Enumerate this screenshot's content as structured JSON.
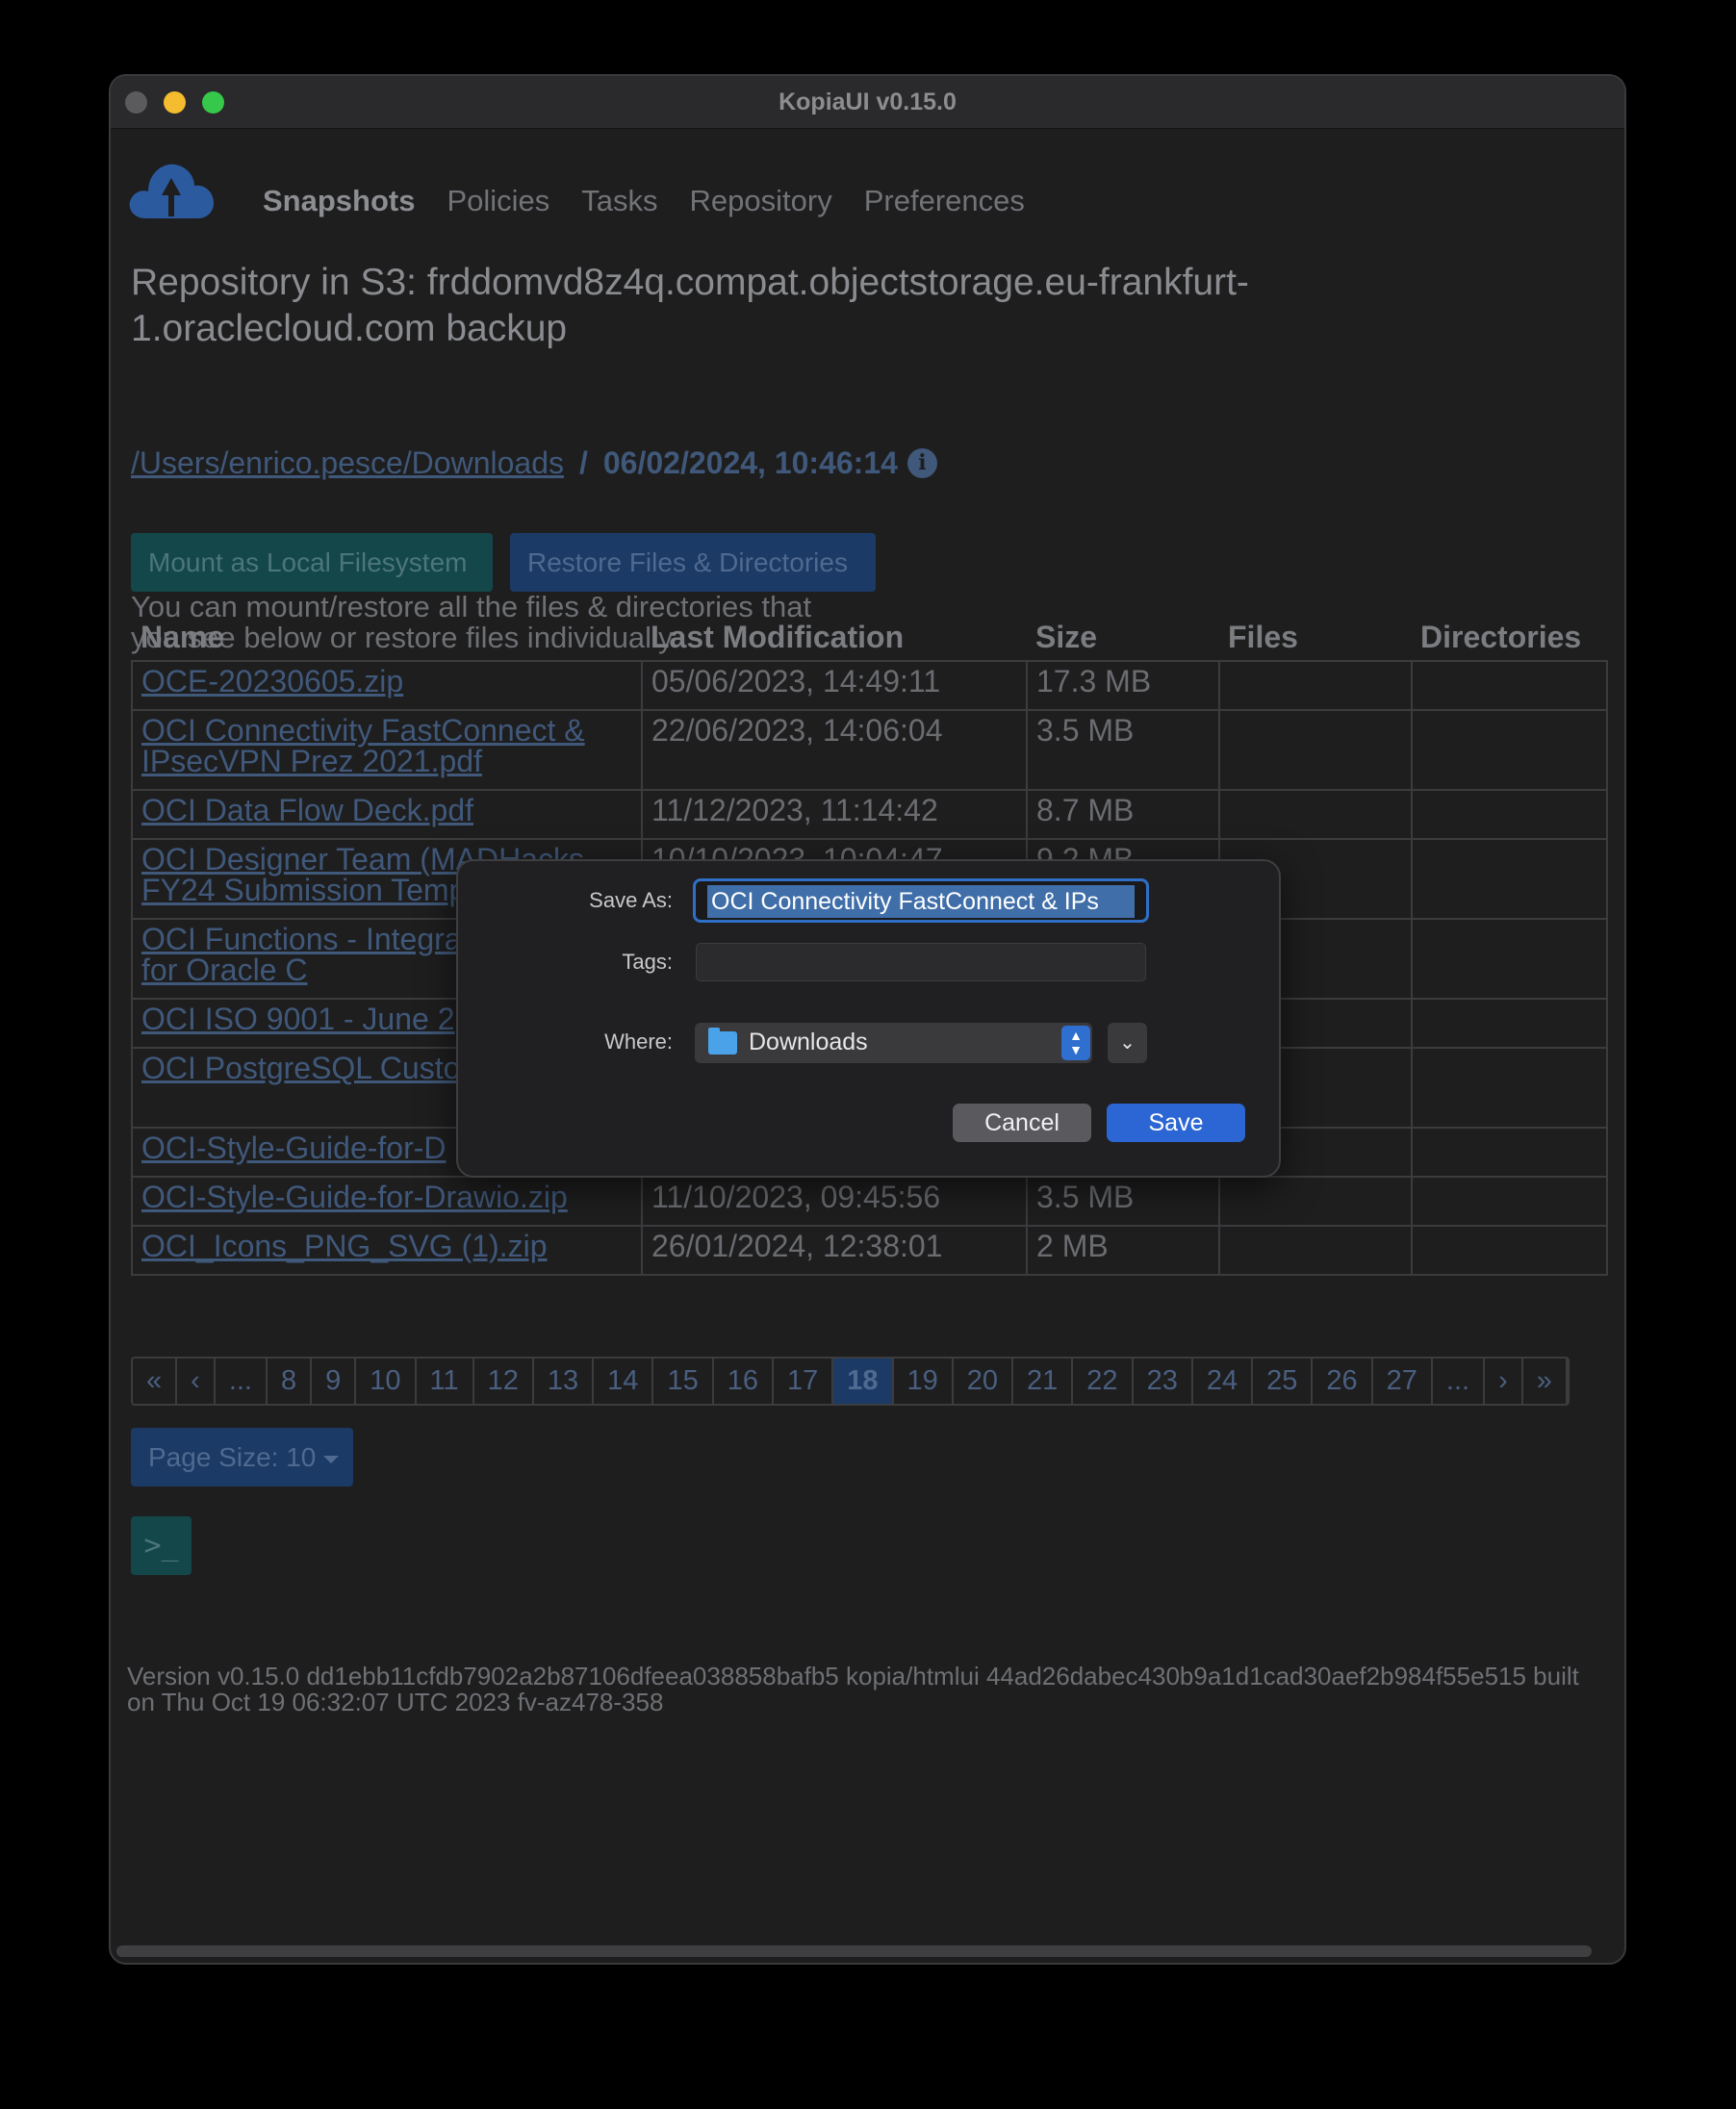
{
  "window": {
    "title": "KopiaUI v0.15.0"
  },
  "nav": {
    "items": [
      "Snapshots",
      "Policies",
      "Tasks",
      "Repository",
      "Preferences"
    ],
    "active": "Snapshots"
  },
  "repository": {
    "title": "Repository in S3: frddomvd8z4q.compat.objectstorage.eu-frankfurt-1.oraclecloud.com backup"
  },
  "breadcrumb": {
    "path": "/Users/enrico.pesce/Downloads",
    "separator": "/",
    "snapshot_time": "06/02/2024, 10:46:14",
    "info_icon": "info-circle-icon"
  },
  "actions": {
    "mount_label": "Mount as Local Filesystem",
    "restore_label": "Restore Files & Directories",
    "hint": "You can mount/restore all the files & directories that you see below or restore files individually."
  },
  "table": {
    "headers": [
      "Name",
      "Last Modification",
      "Size",
      "Files",
      "Directories"
    ],
    "rows": [
      {
        "name": "OCE-20230605.zip",
        "modified": "05/06/2023, 14:49:11",
        "size": "17.3 MB",
        "files": "",
        "dirs": ""
      },
      {
        "name": "OCI Connectivity FastConnect & IPsecVPN Prez 2021.pdf",
        "modified": "22/06/2023, 14:06:04",
        "size": "3.5 MB",
        "files": "",
        "dirs": ""
      },
      {
        "name": "OCI Data Flow Deck.pdf",
        "modified": "11/12/2023, 11:14:42",
        "size": "8.7 MB",
        "files": "",
        "dirs": ""
      },
      {
        "name": "OCI Designer Team (MADHacks FY24 Submission Temp",
        "modified": "10/10/2023, 10:04:47",
        "size": "9.2 MB",
        "files": "",
        "dirs": ""
      },
      {
        "name": "OCI Functions - Integra Monitoring for Oracle C",
        "modified": "",
        "size": "",
        "files": "",
        "dirs": ""
      },
      {
        "name": "OCI ISO 9001 - June 2",
        "modified": "",
        "size": "",
        "files": "",
        "dirs": ""
      },
      {
        "name": "OCI PostgreSQL Custo Deck.pptx",
        "modified": "",
        "size": "",
        "files": "",
        "dirs": ""
      },
      {
        "name": "OCI-Style-Guide-for-D",
        "modified": "",
        "size": "",
        "files": "",
        "dirs": ""
      },
      {
        "name": "OCI-Style-Guide-for-Drawio.zip",
        "modified": "11/10/2023, 09:45:56",
        "size": "3.5 MB",
        "files": "",
        "dirs": ""
      },
      {
        "name": "OCI_Icons_PNG_SVG (1).zip",
        "modified": "26/01/2024, 12:38:01",
        "size": "2 MB",
        "files": "",
        "dirs": ""
      }
    ]
  },
  "pagination": {
    "items": [
      "«",
      "‹",
      "...",
      "8",
      "9",
      "10",
      "11",
      "12",
      "13",
      "14",
      "15",
      "16",
      "17",
      "18",
      "19",
      "20",
      "21",
      "22",
      "23",
      "24",
      "25",
      "26",
      "27",
      "...",
      "›",
      "»"
    ],
    "active": "18"
  },
  "page_size": {
    "label": "Page Size: 10"
  },
  "terminal": {
    "icon": "terminal-icon",
    "glyph": ">_"
  },
  "footer": {
    "version": "Version v0.15.0 dd1ebb11cfdb7902a2b87106dfeea038858bafb5 kopia/htmlui 44ad26dabec430b9a1d1cad30aef2b984f55e515 built on Thu Oct 19 06:32:07 UTC 2023 fv-az478-358"
  },
  "save_dialog": {
    "save_as_label": "Save As:",
    "save_as_value": "OCI Connectivity FastConnect & IPs",
    "tags_label": "Tags:",
    "tags_value": "",
    "where_label": "Where:",
    "where_value": "Downloads",
    "cancel_label": "Cancel",
    "save_label": "Save"
  },
  "colors": {
    "accent": "#2b66d4",
    "link": "#40587a",
    "background": "#1e1e1f"
  }
}
